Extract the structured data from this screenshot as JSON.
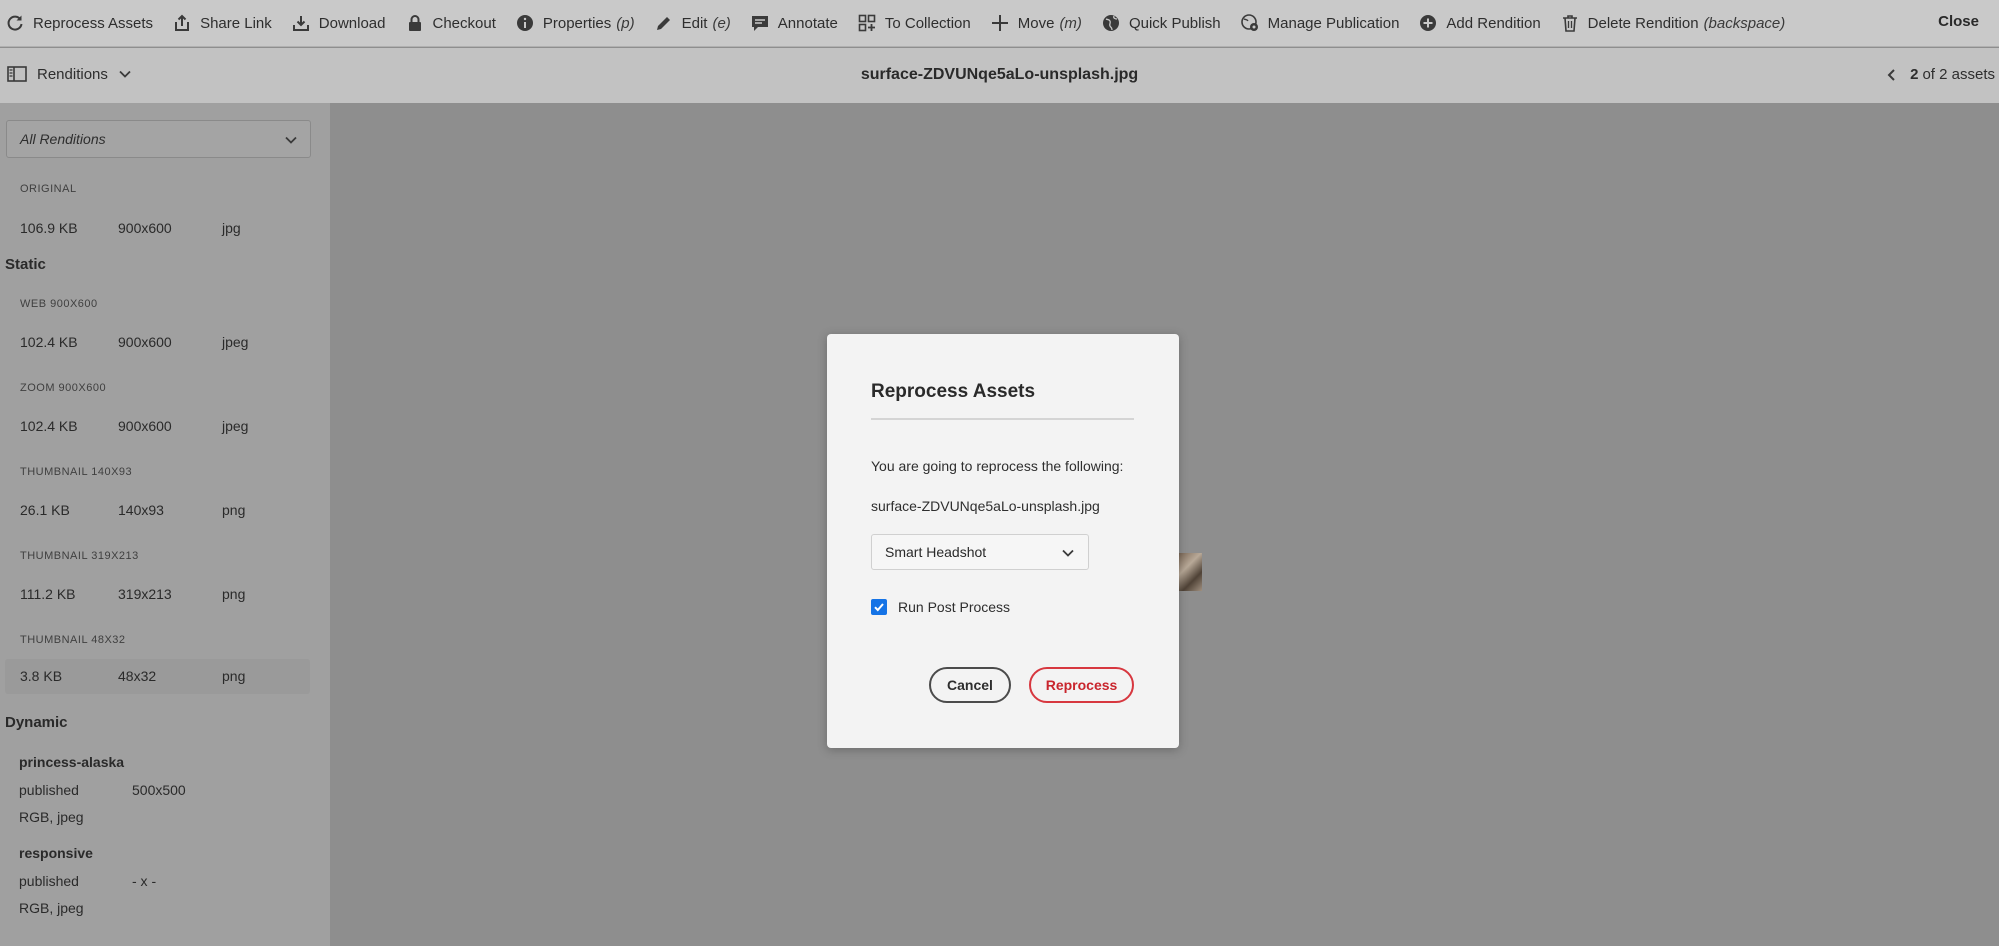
{
  "toolbar": {
    "items": [
      {
        "label": "Reprocess Assets",
        "icon": "refresh-icon"
      },
      {
        "label": "Share Link",
        "icon": "share-icon"
      },
      {
        "label": "Download",
        "icon": "download-icon"
      },
      {
        "label": "Checkout",
        "icon": "lock-icon"
      },
      {
        "label": "Properties",
        "shortcut": "(p)",
        "icon": "info-icon"
      },
      {
        "label": "Edit",
        "shortcut": "(e)",
        "icon": "pencil-icon"
      },
      {
        "label": "Annotate",
        "icon": "comment-icon"
      },
      {
        "label": "To Collection",
        "icon": "collection-icon"
      },
      {
        "label": "Move",
        "shortcut": "(m)",
        "icon": "move-icon"
      },
      {
        "label": "Quick Publish",
        "icon": "globe-icon"
      },
      {
        "label": "Manage Publication",
        "icon": "globe-gear-icon"
      },
      {
        "label": "Add Rendition",
        "icon": "add-circle-icon"
      },
      {
        "label": "Delete Rendition",
        "shortcut": "(backspace)",
        "icon": "trash-icon"
      }
    ],
    "close_label": "Close"
  },
  "header": {
    "renditions_label": "Renditions",
    "asset_title": "surface-ZDVUNqe5aLo-unsplash.jpg",
    "pager_current": "2",
    "pager_rest": "of 2 assets"
  },
  "sidebar": {
    "filter_value": "All Renditions",
    "original": {
      "label": "ORIGINAL",
      "size": "106.9 KB",
      "dims": "900x600",
      "type": "jpg"
    },
    "static_title": "Static",
    "static": [
      {
        "label": "WEB 900X600",
        "size": "102.4 KB",
        "dims": "900x600",
        "type": "jpeg"
      },
      {
        "label": "ZOOM 900X600",
        "size": "102.4 KB",
        "dims": "900x600",
        "type": "jpeg"
      },
      {
        "label": "THUMBNAIL 140X93",
        "size": "26.1 KB",
        "dims": "140x93",
        "type": "png"
      },
      {
        "label": "THUMBNAIL 319X213",
        "size": "111.2 KB",
        "dims": "319x213",
        "type": "png"
      },
      {
        "label": "THUMBNAIL 48X32",
        "size": "3.8 KB",
        "dims": "48x32",
        "type": "png"
      }
    ],
    "dynamic_title": "Dynamic",
    "dynamic": [
      {
        "name": "princess-alaska",
        "status": "published",
        "dims": "500x500",
        "format": "RGB, jpeg"
      },
      {
        "name": "responsive",
        "status": "published",
        "dims": "- x -",
        "format": "RGB, jpeg"
      }
    ]
  },
  "dialog": {
    "title": "Reprocess Assets",
    "message": "You are going to reprocess the following:",
    "filename": "surface-ZDVUNqe5aLo-unsplash.jpg",
    "profile_value": "Smart Headshot",
    "post_process_label": "Run Post Process",
    "post_process_checked": true,
    "cancel_label": "Cancel",
    "reprocess_label": "Reprocess",
    "accent_color": "#1473e6",
    "danger_color": "#d7373f"
  }
}
